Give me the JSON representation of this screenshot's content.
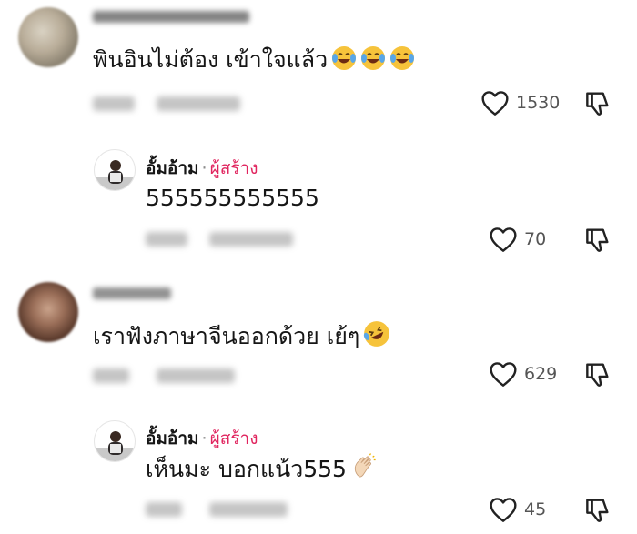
{
  "comments": [
    {
      "text": "พินอินไม่ต้อง เข้าใจแล้ว",
      "emoji": [
        "laughing-tears",
        "laughing-tears",
        "laughing-tears"
      ],
      "likes": "1530",
      "reply": {
        "author": "อั้มอ้าม",
        "dot": "·",
        "creator_label": "ผู้สร้าง",
        "text": "555555555555",
        "likes": "70"
      }
    },
    {
      "text": "เราฟังภาษาจีนออกด้วย เย้ๆ",
      "emoji": [
        "rolling-laughing"
      ],
      "likes": "629",
      "reply": {
        "author": "อั้มอ้าม",
        "dot": "·",
        "creator_label": "ผู้สร้าง",
        "text": "เห็นมะ บอกแน้ว555",
        "emoji": [
          "clapping-hands"
        ],
        "likes": "45"
      }
    }
  ],
  "colors": {
    "creator": "#e0245e",
    "meta": "#555555",
    "icon": "#222222"
  }
}
